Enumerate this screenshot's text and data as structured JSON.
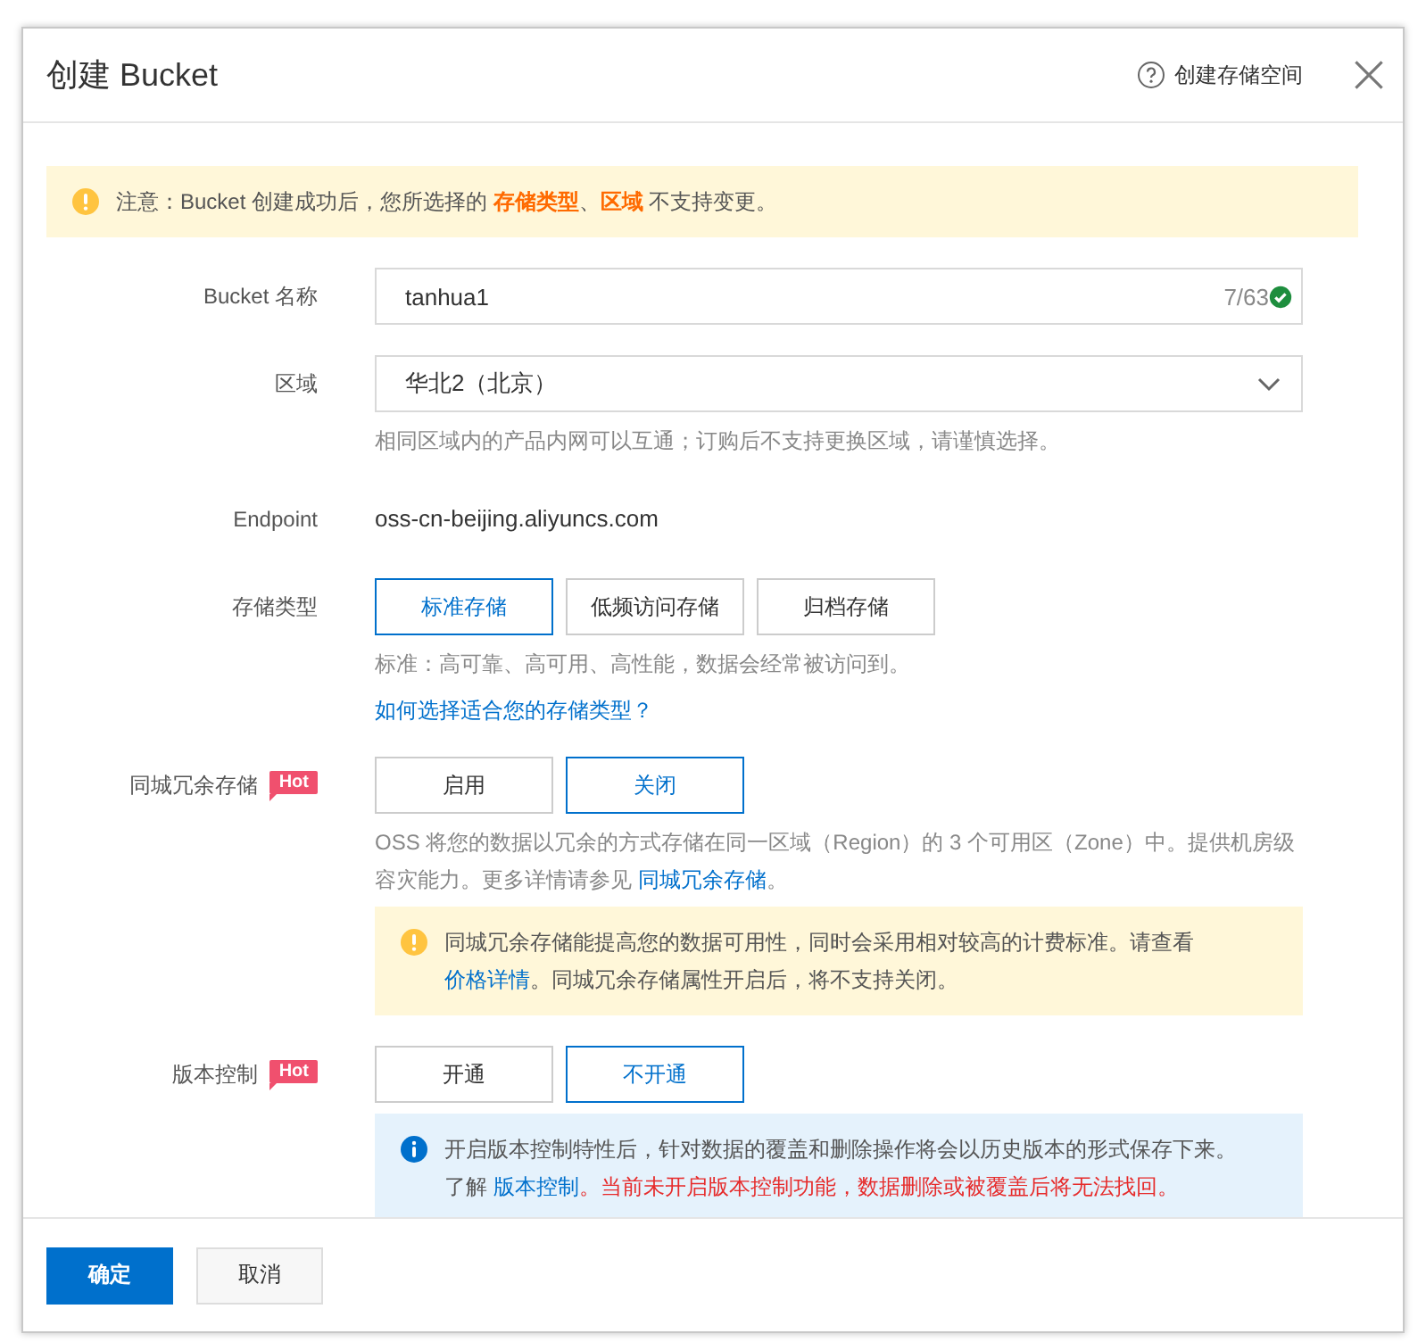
{
  "dialog": {
    "title": "创建 Bucket",
    "help_link": "创建存储空间"
  },
  "notice": {
    "kind": "warning",
    "lines": [
      [
        {
          "kind": "plain",
          "text": "注意：Bucket 创建成功后，您所选择的 "
        },
        {
          "kind": "accent",
          "text": "存储类型"
        },
        {
          "kind": "plain",
          "text": "、"
        },
        {
          "kind": "accent",
          "text": "区域"
        },
        {
          "kind": "plain",
          "text": " 不支持变更。"
        }
      ]
    ]
  },
  "fields": [
    {
      "kind": "text_input",
      "label": "Bucket 名称",
      "value": "tanhua1",
      "counter": "7/63",
      "valid": true
    },
    {
      "kind": "select",
      "label": "区域",
      "value": "华北2（北京）",
      "hint": [
        {
          "kind": "plain",
          "text": "相同区域内的产品内网可以互通；订购后不支持更换区域，请谨慎选择。"
        }
      ]
    },
    {
      "kind": "static",
      "label": "Endpoint",
      "value": "oss-cn-beijing.aliyuncs.com"
    },
    {
      "kind": "options",
      "label": "存储类型",
      "options": [
        {
          "label": "标准存储",
          "selected": true
        },
        {
          "label": "低频访问存储",
          "selected": false
        },
        {
          "label": "归档存储",
          "selected": false
        }
      ],
      "hint": [
        {
          "kind": "plain",
          "text": "标准：高可靠、高可用、高性能，数据会经常被访问到。"
        }
      ],
      "link": "如何选择适合您的存储类型？"
    },
    {
      "kind": "options",
      "label": "同城冗余存储",
      "badge": "Hot",
      "options": [
        {
          "label": "启用",
          "selected": false
        },
        {
          "label": "关闭",
          "selected": true
        }
      ],
      "hint": [
        {
          "kind": "plain",
          "text": "OSS 将您的数据以冗余的方式存储在同一区域（Region）的 3 个可用区（Zone）中。提供机房级容灾能力。更多详情请参见 "
        },
        {
          "kind": "link",
          "text": "同城冗余存储"
        },
        {
          "kind": "plain",
          "text": "。"
        }
      ],
      "alert": {
        "kind": "warning",
        "lines": [
          [
            {
              "kind": "plain",
              "text": "同城冗余存储能提高您的数据可用性，同时会采用相对较高的计费标准。请查看"
            }
          ],
          [
            {
              "kind": "link",
              "text": "价格详情"
            },
            {
              "kind": "plain",
              "text": "。同城冗余存储属性开启后，将不支持关闭。"
            }
          ]
        ]
      }
    },
    {
      "kind": "options",
      "label": "版本控制",
      "badge": "Hot",
      "options": [
        {
          "label": "开通",
          "selected": false
        },
        {
          "label": "不开通",
          "selected": true
        }
      ],
      "alert": {
        "kind": "info",
        "lines": [
          [
            {
              "kind": "plain",
              "text": "开启版本控制特性后，针对数据的覆盖和删除操作将会以历史版本的形式保存下来。"
            }
          ],
          [
            {
              "kind": "plain",
              "text": "了解 "
            },
            {
              "kind": "link",
              "text": "版本控制"
            },
            {
              "kind": "danger",
              "text": "。当前未开启版本控制功能，数据删除或被覆盖后将无法找回。"
            }
          ]
        ]
      }
    }
  ],
  "footer": {
    "buttons": [
      {
        "label": "确定",
        "primary": true
      },
      {
        "label": "取消",
        "primary": false
      }
    ]
  }
}
